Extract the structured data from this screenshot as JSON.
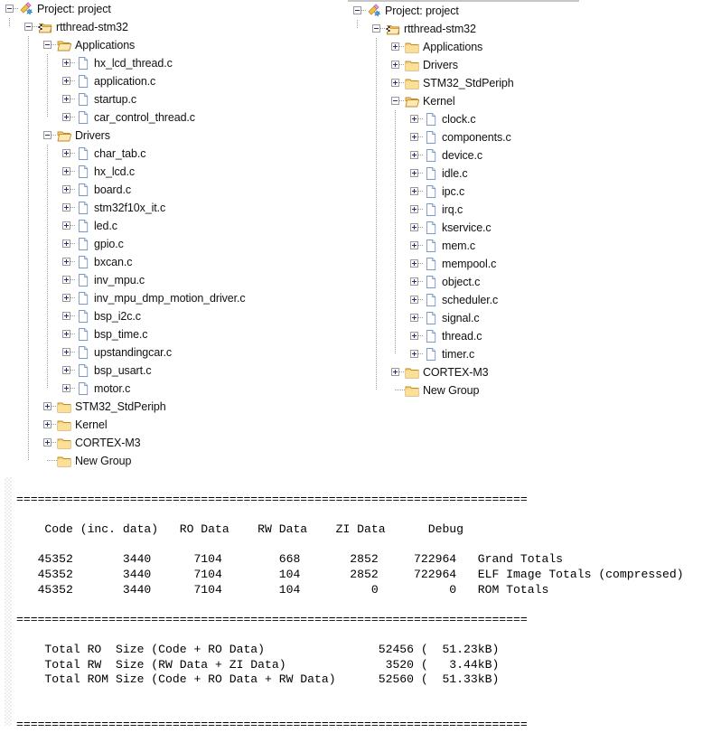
{
  "panels": {
    "left": {
      "name": "project-tree-left",
      "nodes": [
        {
          "depth": 0,
          "state": "expanded",
          "icon": "project-icon",
          "label": "Project: project"
        },
        {
          "depth": 1,
          "state": "expanded",
          "icon": "target-folder-icon",
          "label": "rtthread-stm32"
        },
        {
          "depth": 2,
          "state": "expanded",
          "icon": "folder-open-icon",
          "label": "Applications"
        },
        {
          "depth": 3,
          "state": "collapsed",
          "icon": "c-file-icon",
          "label": "hx_lcd_thread.c"
        },
        {
          "depth": 3,
          "state": "collapsed",
          "icon": "c-file-icon",
          "label": "application.c"
        },
        {
          "depth": 3,
          "state": "collapsed",
          "icon": "c-file-icon",
          "label": "startup.c"
        },
        {
          "depth": 3,
          "state": "collapsed",
          "icon": "c-file-icon",
          "label": "car_control_thread.c"
        },
        {
          "depth": 2,
          "state": "expanded",
          "icon": "folder-open-icon",
          "label": "Drivers"
        },
        {
          "depth": 3,
          "state": "collapsed",
          "icon": "c-file-icon",
          "label": "char_tab.c"
        },
        {
          "depth": 3,
          "state": "collapsed",
          "icon": "c-file-icon",
          "label": "hx_lcd.c"
        },
        {
          "depth": 3,
          "state": "collapsed",
          "icon": "c-file-icon",
          "label": "board.c"
        },
        {
          "depth": 3,
          "state": "collapsed",
          "icon": "c-file-icon",
          "label": "stm32f10x_it.c"
        },
        {
          "depth": 3,
          "state": "collapsed",
          "icon": "c-file-icon",
          "label": "led.c"
        },
        {
          "depth": 3,
          "state": "collapsed",
          "icon": "c-file-icon",
          "label": "gpio.c"
        },
        {
          "depth": 3,
          "state": "collapsed",
          "icon": "c-file-icon",
          "label": "bxcan.c"
        },
        {
          "depth": 3,
          "state": "collapsed",
          "icon": "c-file-icon",
          "label": "inv_mpu.c"
        },
        {
          "depth": 3,
          "state": "collapsed",
          "icon": "c-file-icon",
          "label": "inv_mpu_dmp_motion_driver.c"
        },
        {
          "depth": 3,
          "state": "collapsed",
          "icon": "c-file-icon",
          "label": "bsp_i2c.c"
        },
        {
          "depth": 3,
          "state": "collapsed",
          "icon": "c-file-icon",
          "label": "bsp_time.c"
        },
        {
          "depth": 3,
          "state": "collapsed",
          "icon": "c-file-icon",
          "label": "upstandingcar.c"
        },
        {
          "depth": 3,
          "state": "collapsed",
          "icon": "c-file-icon",
          "label": "bsp_usart.c"
        },
        {
          "depth": 3,
          "state": "collapsed",
          "icon": "c-file-icon",
          "label": "motor.c"
        },
        {
          "depth": 2,
          "state": "collapsed",
          "icon": "folder-icon",
          "label": "STM32_StdPeriph"
        },
        {
          "depth": 2,
          "state": "collapsed",
          "icon": "folder-icon",
          "label": "Kernel"
        },
        {
          "depth": 2,
          "state": "collapsed",
          "icon": "folder-icon",
          "label": "CORTEX-M3"
        },
        {
          "depth": 2,
          "state": "leaf",
          "icon": "folder-icon",
          "label": "New Group"
        }
      ]
    },
    "right": {
      "name": "project-tree-right",
      "nodes": [
        {
          "depth": 0,
          "state": "expanded",
          "icon": "project-icon",
          "label": "Project: project"
        },
        {
          "depth": 1,
          "state": "expanded",
          "icon": "target-folder-icon",
          "label": "rtthread-stm32"
        },
        {
          "depth": 2,
          "state": "collapsed",
          "icon": "folder-icon",
          "label": "Applications"
        },
        {
          "depth": 2,
          "state": "collapsed",
          "icon": "folder-icon",
          "label": "Drivers"
        },
        {
          "depth": 2,
          "state": "collapsed",
          "icon": "folder-icon",
          "label": "STM32_StdPeriph"
        },
        {
          "depth": 2,
          "state": "expanded",
          "icon": "folder-open-icon",
          "label": "Kernel"
        },
        {
          "depth": 3,
          "state": "collapsed",
          "icon": "c-file-icon",
          "label": "clock.c"
        },
        {
          "depth": 3,
          "state": "collapsed",
          "icon": "c-file-icon",
          "label": "components.c"
        },
        {
          "depth": 3,
          "state": "collapsed",
          "icon": "c-file-icon",
          "label": "device.c"
        },
        {
          "depth": 3,
          "state": "collapsed",
          "icon": "c-file-icon",
          "label": "idle.c"
        },
        {
          "depth": 3,
          "state": "collapsed",
          "icon": "c-file-icon",
          "label": "ipc.c"
        },
        {
          "depth": 3,
          "state": "collapsed",
          "icon": "c-file-icon",
          "label": "irq.c"
        },
        {
          "depth": 3,
          "state": "collapsed",
          "icon": "c-file-icon",
          "label": "kservice.c"
        },
        {
          "depth": 3,
          "state": "collapsed",
          "icon": "c-file-icon",
          "label": "mem.c"
        },
        {
          "depth": 3,
          "state": "collapsed",
          "icon": "c-file-icon",
          "label": "mempool.c"
        },
        {
          "depth": 3,
          "state": "collapsed",
          "icon": "c-file-icon",
          "label": "object.c"
        },
        {
          "depth": 3,
          "state": "collapsed",
          "icon": "c-file-icon",
          "label": "scheduler.c"
        },
        {
          "depth": 3,
          "state": "collapsed",
          "icon": "c-file-icon",
          "label": "signal.c"
        },
        {
          "depth": 3,
          "state": "collapsed",
          "icon": "c-file-icon",
          "label": "thread.c"
        },
        {
          "depth": 3,
          "state": "collapsed",
          "icon": "c-file-icon",
          "label": "timer.c"
        },
        {
          "depth": 2,
          "state": "collapsed",
          "icon": "folder-icon",
          "label": "CORTEX-M3"
        },
        {
          "depth": 2,
          "state": "leaf",
          "icon": "folder-icon",
          "label": "New Group"
        }
      ]
    }
  },
  "build_output": {
    "name": "build-output-log",
    "lines": [
      "========================================================================",
      "",
      "    Code (inc. data)   RO Data    RW Data    ZI Data      Debug",
      "",
      "   45352       3440      7104        668       2852     722964   Grand Totals",
      "   45352       3440      7104        104       2852     722964   ELF Image Totals (compressed)",
      "   45352       3440      7104        104          0          0   ROM Totals",
      "",
      "========================================================================",
      "",
      "    Total RO  Size (Code + RO Data)                52456 (  51.23kB)",
      "    Total RW  Size (RW Data + ZI Data)              3520 (   3.44kB)",
      "    Total ROM Size (Code + RO Data + RW Data)      52560 (  51.33kB)",
      "",
      "",
      "========================================================================"
    ],
    "table": {
      "headers": [
        "Code (inc. data)",
        "RO Data",
        "RW Data",
        "ZI Data",
        "Debug",
        ""
      ],
      "rows": [
        {
          "code": "45352",
          "inc_data": "3440",
          "ro_data": "7104",
          "rw_data": "668",
          "zi_data": "2852",
          "debug": "722964",
          "label": "Grand Totals"
        },
        {
          "code": "45352",
          "inc_data": "3440",
          "ro_data": "7104",
          "rw_data": "104",
          "zi_data": "2852",
          "debug": "722964",
          "label": "ELF Image Totals (compressed)"
        },
        {
          "code": "45352",
          "inc_data": "3440",
          "ro_data": "7104",
          "rw_data": "104",
          "zi_data": "0",
          "debug": "0",
          "label": "ROM Totals"
        }
      ],
      "totals": [
        {
          "label": "Total RO  Size (Code + RO Data)",
          "bytes": "52456",
          "kb": "51.23kB"
        },
        {
          "label": "Total RW  Size (RW Data + ZI Data)",
          "bytes": "3520",
          "kb": "3.44kB"
        },
        {
          "label": "Total ROM Size (Code + RO Data + RW Data)",
          "bytes": "52560",
          "kb": "51.33kB"
        }
      ]
    }
  },
  "colors": {
    "folder": "#f8d37a",
    "folder_border": "#c08a22",
    "file": "#ffffff",
    "file_border": "#7a96c8",
    "expander_glyph": "#2b2b7f",
    "guide_line": "#9a9a9a",
    "panel_border": "#c6c6c6",
    "text": "#111111"
  }
}
